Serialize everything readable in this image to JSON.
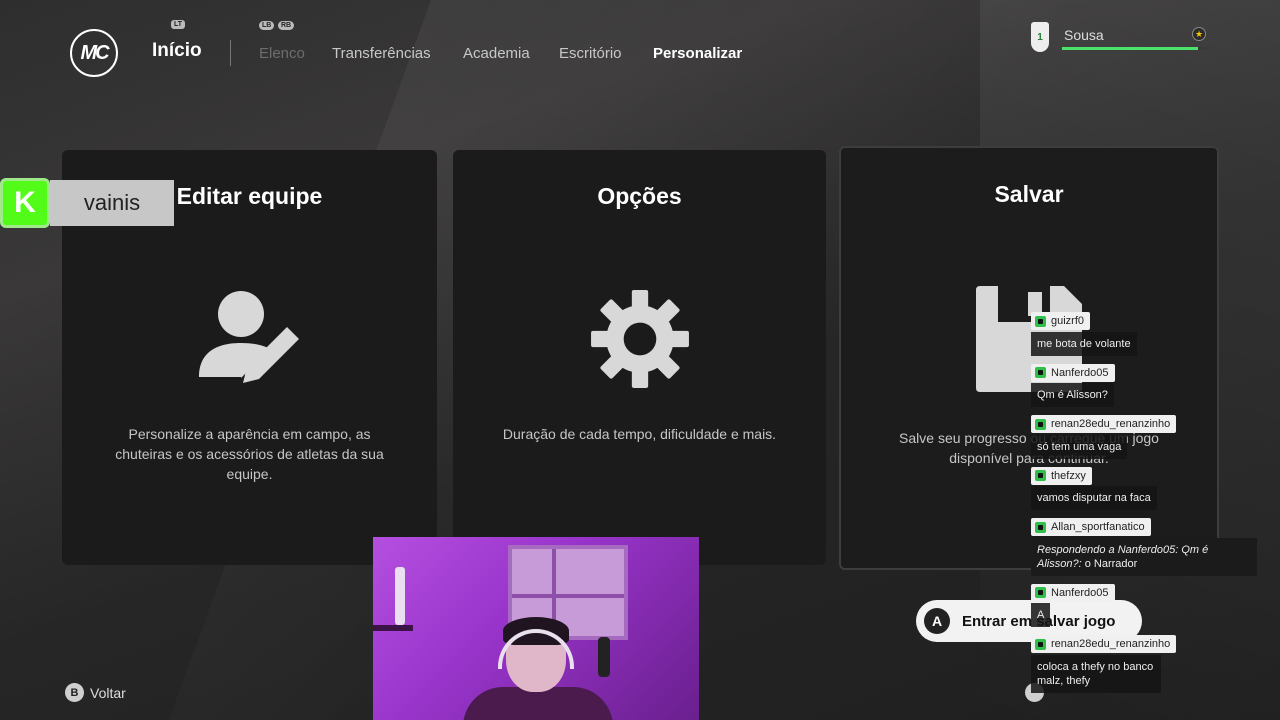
{
  "nav": {
    "logo": "MC",
    "home": "Início",
    "hints": {
      "lt": "LT",
      "lb": "LB",
      "rb": "RB"
    },
    "items": [
      {
        "label": "Elenco",
        "state": "dim"
      },
      {
        "label": "Transferências",
        "state": "normal"
      },
      {
        "label": "Academia",
        "state": "normal"
      },
      {
        "label": "Escritório",
        "state": "normal"
      },
      {
        "label": "Personalizar",
        "state": "active"
      }
    ]
  },
  "profile": {
    "name": "Sousa",
    "badge": "1",
    "progress": 0.92
  },
  "streamer": {
    "platform_icon": "K",
    "name": "vainis"
  },
  "cards": [
    {
      "title": "Editar equipe",
      "description": "Personalize a aparência em campo, as chuteiras e os acessórios de atletas da sua equipe.",
      "icon": "edit-user-icon"
    },
    {
      "title": "Opções",
      "description": "Duração de cada tempo, dificuldade e mais.",
      "icon": "gear-icon"
    },
    {
      "title": "Salvar",
      "description": "Salve seu progresso ou carregue um jogo disponível para continuar.",
      "icon": "floppy-disk-icon"
    }
  ],
  "action": {
    "glyph": "A",
    "label": "Entrar em salvar jogo"
  },
  "footer": {
    "back_glyph": "B",
    "back_label": "Voltar"
  },
  "chat": [
    {
      "user": "guizrf0",
      "message": "me bota de volante"
    },
    {
      "user": "Nanferdo05",
      "message": "Qm é Alisson?"
    },
    {
      "user": "renan28edu_renanzinho",
      "message": "só tem uma vaga"
    },
    {
      "user": "thefzxy",
      "message": "vamos disputar na faca"
    },
    {
      "user": "Allan_sportfanatico",
      "reply": "Respondendo a Nanferdo05: Qm é Alisson?:",
      "message": "o Narrador"
    },
    {
      "user": "Nanferdo05",
      "message": "A"
    },
    {
      "user": "renan28edu_renanzinho",
      "message": "coloca a thefy no banco malz, thefy"
    }
  ]
}
